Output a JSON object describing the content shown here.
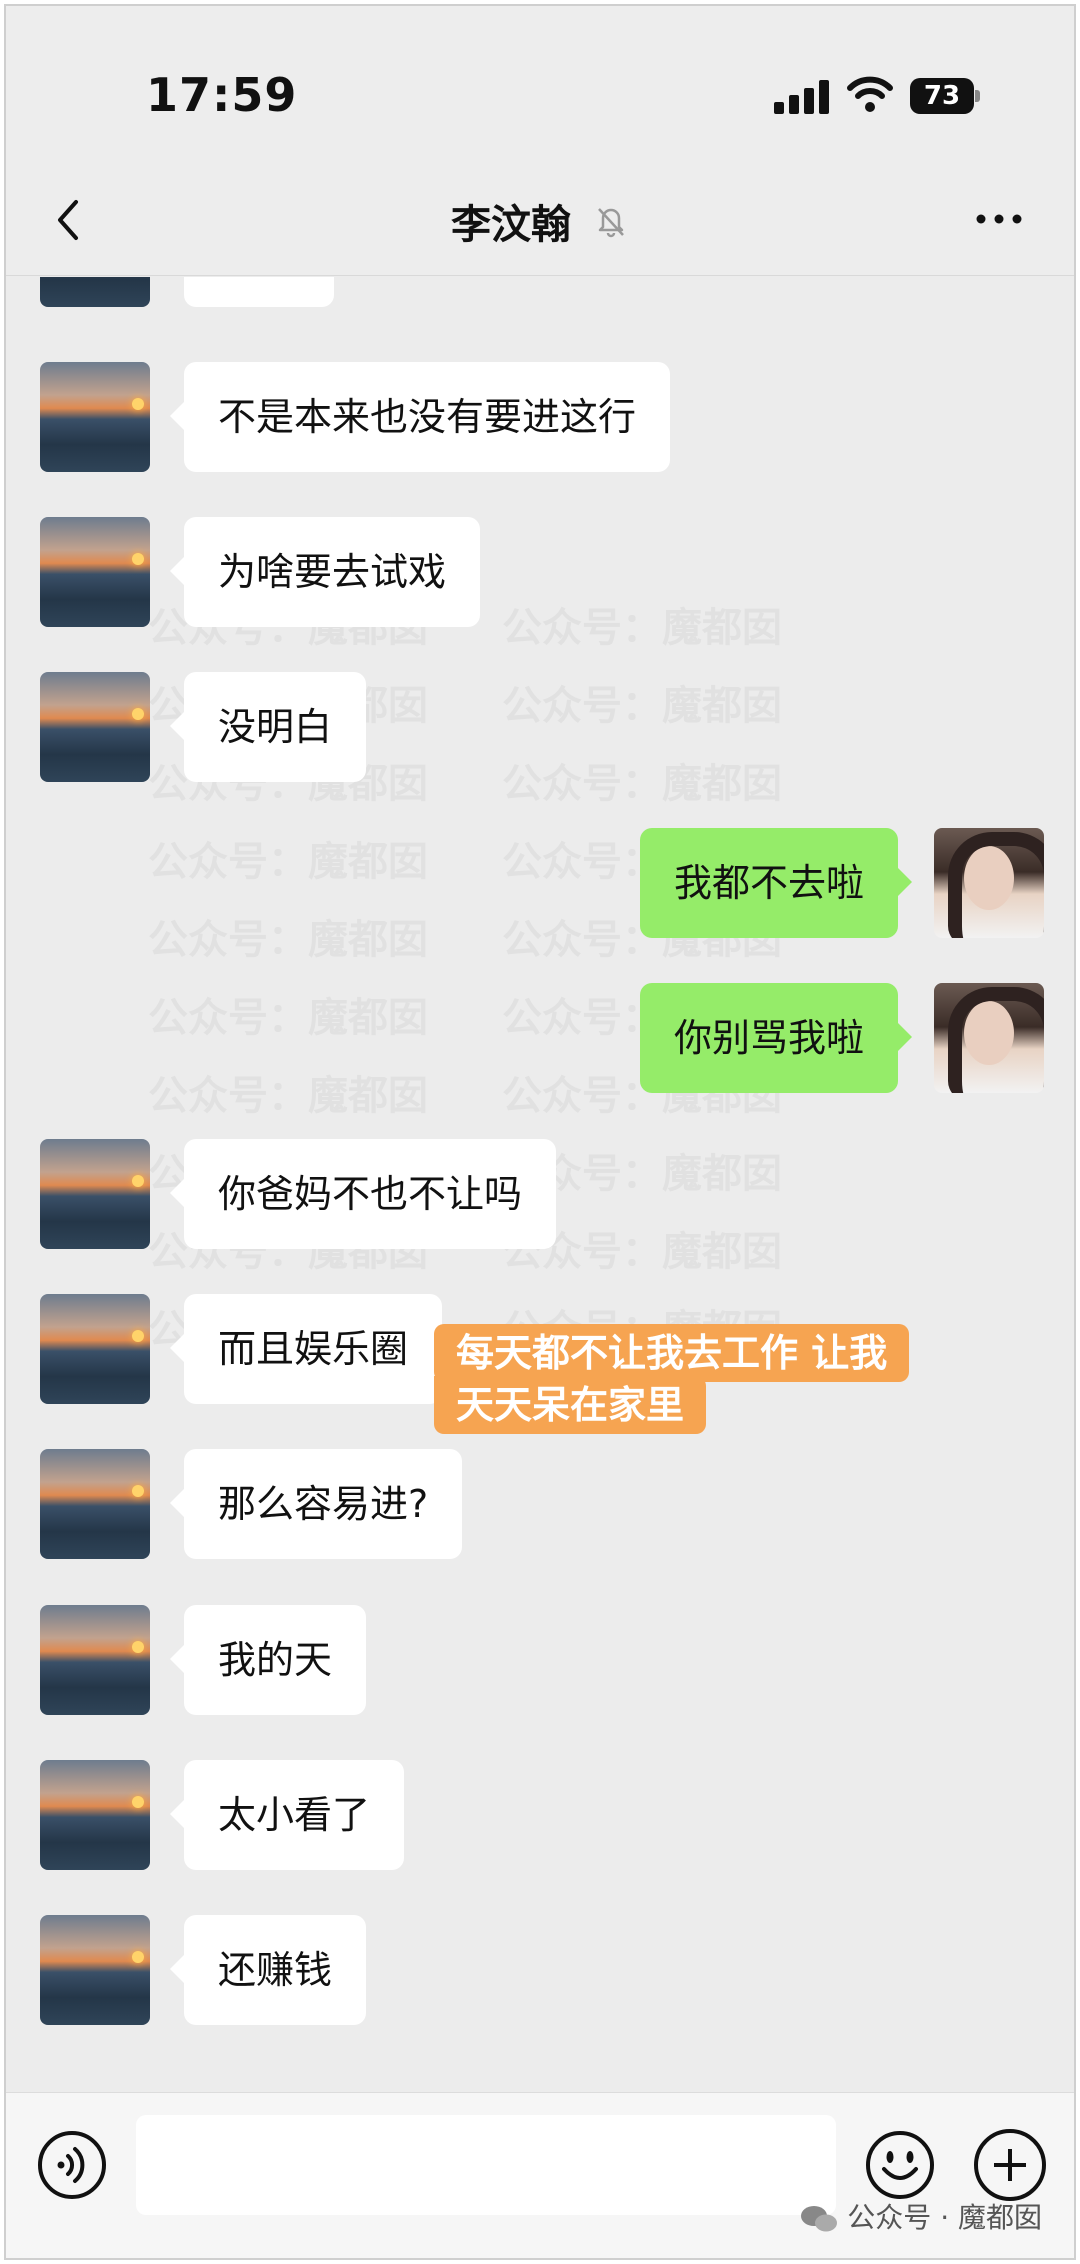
{
  "status_bar": {
    "time": "17:59",
    "battery": "73"
  },
  "header": {
    "title": "李汶翰"
  },
  "messages": [
    {
      "side": "in",
      "text": "不是本来也没有要进这行"
    },
    {
      "side": "in",
      "text": "为啥要去试戏"
    },
    {
      "side": "in",
      "text": "没明白"
    },
    {
      "side": "out",
      "text": "我都不去啦"
    },
    {
      "side": "out",
      "text": "你别骂我啦"
    },
    {
      "side": "in",
      "text": "你爸妈不也不让吗"
    },
    {
      "side": "in",
      "text": "而且娱乐圈"
    },
    {
      "side": "in",
      "text": "那么容易进?"
    },
    {
      "side": "in",
      "text": "我的天"
    },
    {
      "side": "in",
      "text": "太小看了"
    },
    {
      "side": "in",
      "text": "还赚钱"
    }
  ],
  "caption": {
    "line1": "每天都不让我去工作 让我",
    "line2": "天天呆在家里"
  },
  "watermark": {
    "text": "公众号：魔都囡",
    "footer": "公众号 · 魔都囡"
  },
  "icons": {
    "back": "chevron-left-icon",
    "mute": "bell-muted-icon",
    "more": "more-dots-icon",
    "voice": "voice-icon",
    "emoji": "emoji-icon",
    "plus": "plus-icon"
  }
}
